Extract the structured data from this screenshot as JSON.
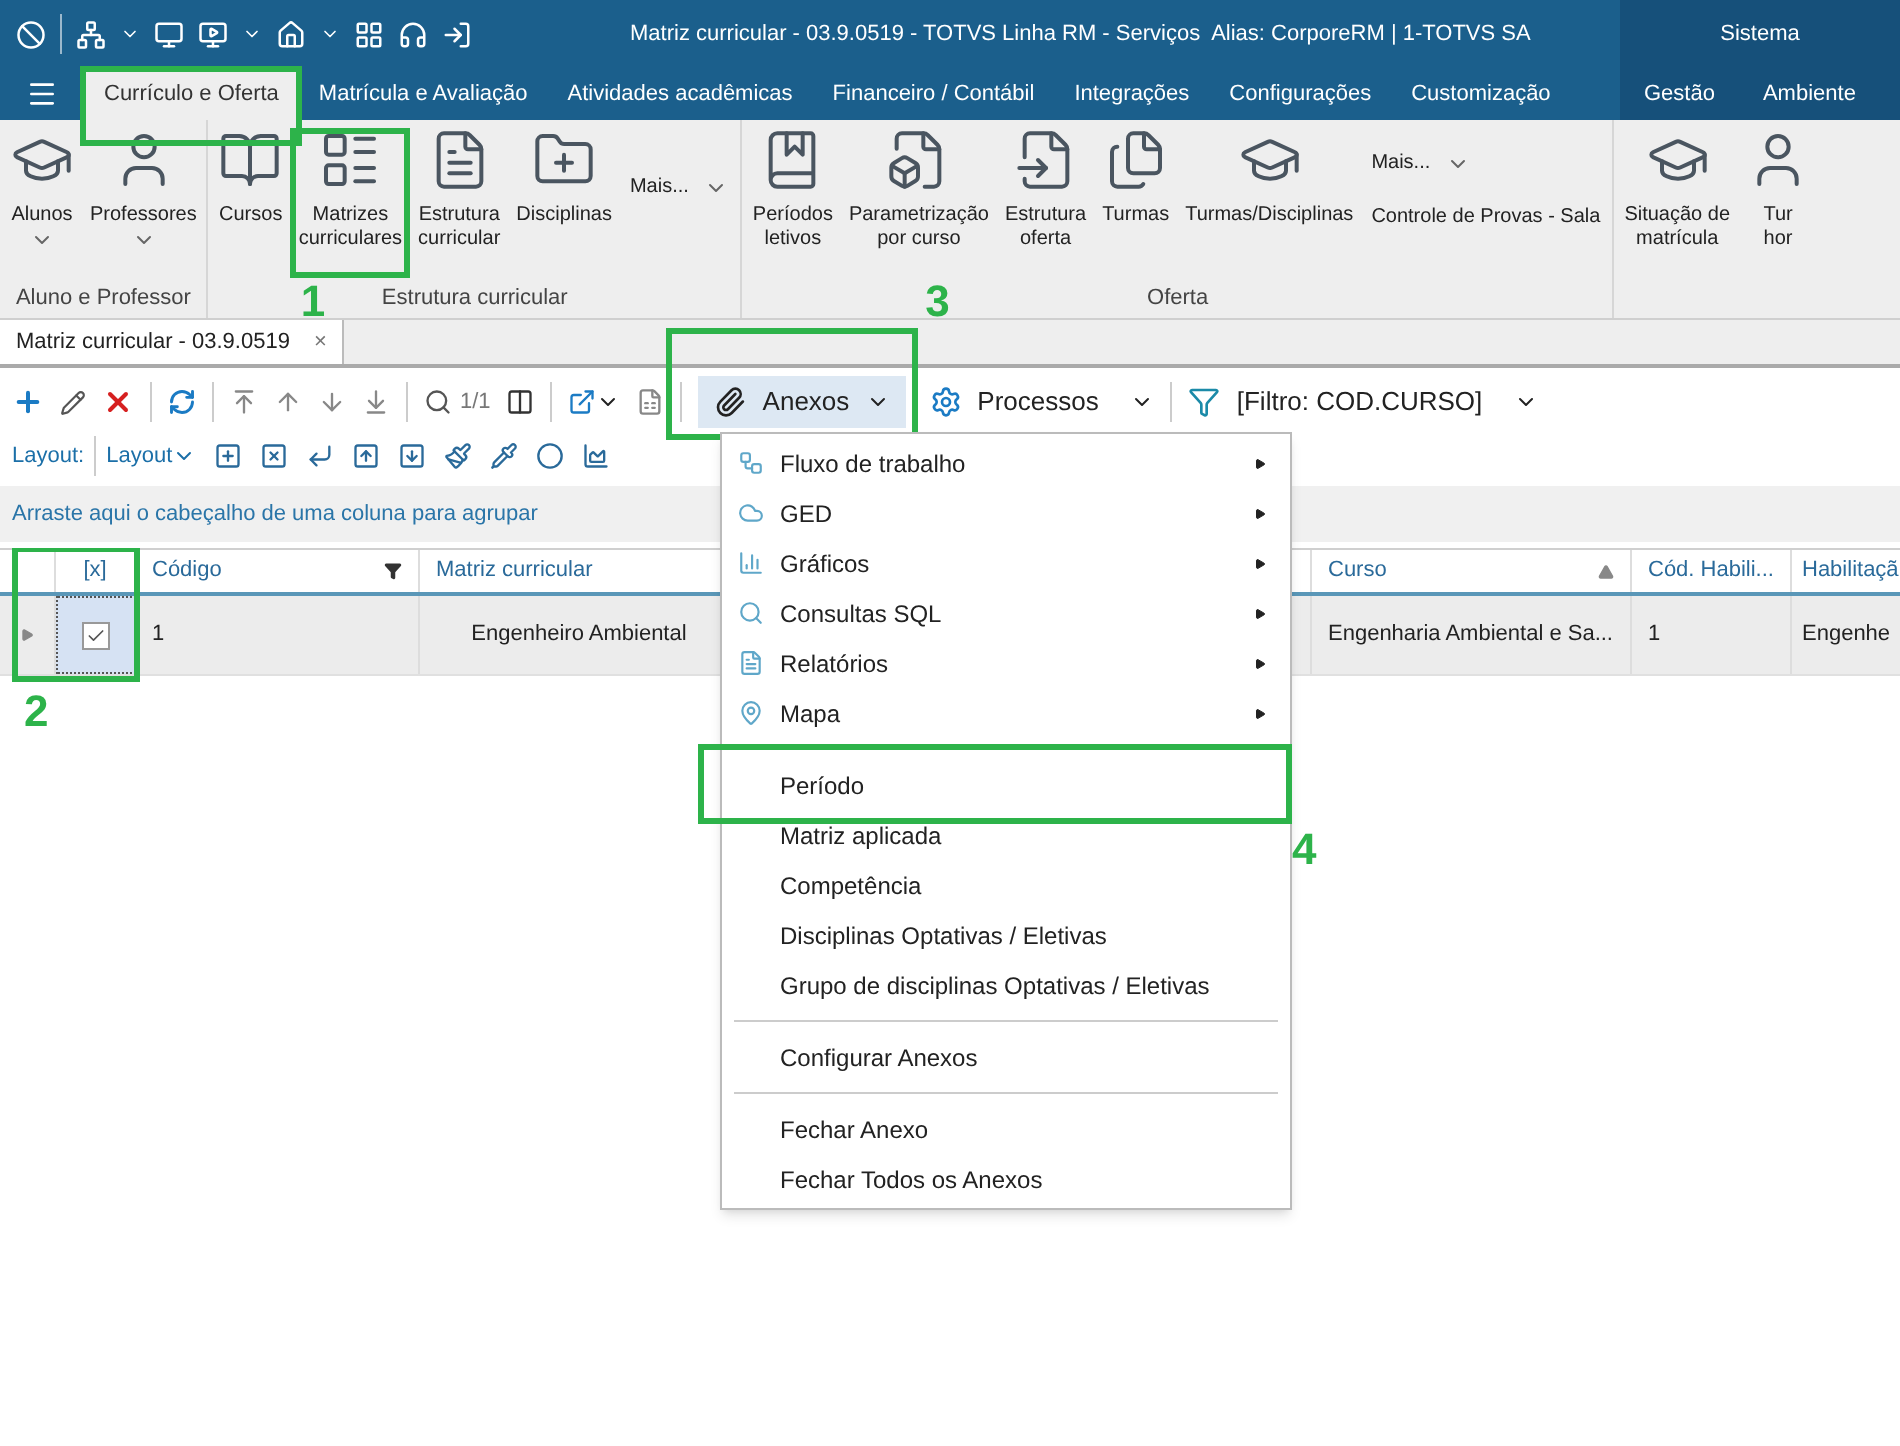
{
  "window": {
    "title": "Matriz curricular - 03.9.0519 - TOTVS Linha RM - Serviços  Alias: CorporeRM | 1-TOTVS SA",
    "system_label": "Sistema"
  },
  "tabs": [
    {
      "label": "Currículo e Oferta",
      "selected": true
    },
    {
      "label": "Matrícula e Avaliação",
      "selected": false
    },
    {
      "label": "Atividades acadêmicas",
      "selected": false
    },
    {
      "label": "Financeiro / Contábil",
      "selected": false
    },
    {
      "label": "Integrações",
      "selected": false
    },
    {
      "label": "Configurações",
      "selected": false
    },
    {
      "label": "Customização",
      "selected": false
    }
  ],
  "system_tabs": [
    {
      "label": "Gestão",
      "selected": false
    },
    {
      "label": "Ambiente",
      "selected": false
    }
  ],
  "ribbon": {
    "groups": [
      {
        "label": "Aluno e Professor",
        "items": [
          {
            "kind": "button",
            "lines": [
              "Alunos"
            ],
            "dropdown": true
          },
          {
            "kind": "button",
            "lines": [
              "Professores"
            ],
            "dropdown": true
          }
        ]
      },
      {
        "label": "Estrutura curricular",
        "items": [
          {
            "kind": "button",
            "lines": [
              "Cursos"
            ],
            "dropdown": false
          },
          {
            "kind": "button",
            "lines": [
              "Matrizes",
              "curriculares"
            ],
            "dropdown": false
          },
          {
            "kind": "button",
            "lines": [
              "Estrutura",
              "curricular"
            ],
            "dropdown": false
          },
          {
            "kind": "button",
            "lines": [
              "Disciplinas"
            ],
            "dropdown": false
          },
          {
            "kind": "more",
            "label": "Mais..."
          }
        ]
      },
      {
        "label": "Oferta",
        "items": [
          {
            "kind": "button",
            "lines": [
              "Períodos",
              "letivos"
            ],
            "dropdown": false
          },
          {
            "kind": "button",
            "lines": [
              "Parametrização",
              "por curso"
            ],
            "dropdown": false
          },
          {
            "kind": "button",
            "lines": [
              "Estrutura",
              "oferta"
            ],
            "dropdown": false
          },
          {
            "kind": "button",
            "lines": [
              "Turmas"
            ],
            "dropdown": false
          },
          {
            "kind": "button",
            "lines": [
              "Turmas/Disciplinas"
            ],
            "dropdown": false
          },
          {
            "kind": "more_stack",
            "label": "Mais...",
            "sub": "Controle de Provas - Sala"
          }
        ]
      },
      {
        "items": [
          {
            "kind": "button",
            "lines": [
              "Situação de",
              "matrícula"
            ],
            "dropdown": false
          },
          {
            "kind": "button",
            "lines": [
              "Tur",
              "hor"
            ],
            "dropdown": false
          }
        ]
      }
    ]
  },
  "document_tab": {
    "label": "Matriz curricular - 03.9.0519",
    "close": "×"
  },
  "toolbar": {
    "record_counter": "1/1",
    "anexos": {
      "label": "Anexos",
      "expanded": true
    },
    "processos": "Processos",
    "filter": "[Filtro: COD.CURSO]",
    "layout_label": "Layout:",
    "layout_button": "Layout"
  },
  "group_panel": "Arraste aqui o cabeçalho de uma coluna para agrupar",
  "table": {
    "columns": [
      {
        "label": "[x]"
      },
      {
        "label": "Código"
      },
      {
        "label": "Matriz curricular"
      },
      {
        "label": "Curso",
        "sorted": true
      },
      {
        "label": "Cód. Habili..."
      },
      {
        "label": "Habilitaçã"
      }
    ],
    "rows": [
      {
        "selected": true,
        "cells": [
          {
            "kind": "checkbox",
            "checked": true
          },
          {
            "kind": "text",
            "text": "1"
          },
          {
            "kind": "text",
            "text": "Engenheiro Ambiental"
          },
          {
            "kind": "text",
            "text": "Engenharia Ambiental e Sa..."
          },
          {
            "kind": "text",
            "text": "1"
          },
          {
            "kind": "text",
            "text": "Engenhe"
          }
        ]
      }
    ]
  },
  "menu": [
    {
      "kind": "submenu",
      "label": "Fluxo de trabalho"
    },
    {
      "kind": "submenu",
      "label": "GED"
    },
    {
      "kind": "submenu",
      "label": "Gráficos"
    },
    {
      "kind": "submenu",
      "label": "Consultas SQL"
    },
    {
      "kind": "submenu",
      "label": "Relatórios"
    },
    {
      "kind": "submenu",
      "label": "Mapa"
    },
    {
      "kind": "separator"
    },
    {
      "kind": "item",
      "label": "Período"
    },
    {
      "kind": "item",
      "label": "Matriz aplicada"
    },
    {
      "kind": "item",
      "label": "Competência"
    },
    {
      "kind": "item",
      "label": "Disciplinas Optativas / Eletivas"
    },
    {
      "kind": "item",
      "label": "Grupo de disciplinas Optativas / Eletivas"
    },
    {
      "kind": "separator"
    },
    {
      "kind": "item",
      "label": "Configurar Anexos"
    },
    {
      "kind": "separator"
    },
    {
      "kind": "item",
      "label": "Fechar Anexo"
    },
    {
      "kind": "item",
      "label": "Fechar Todos os Anexos"
    }
  ],
  "annotations": [
    {
      "label": "1"
    },
    {
      "label": "2"
    },
    {
      "label": "3"
    },
    {
      "label": "4"
    }
  ]
}
